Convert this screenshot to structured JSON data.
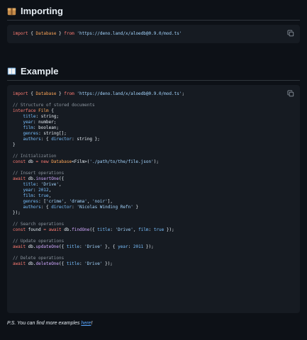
{
  "sections": {
    "importing": {
      "title": "Importing",
      "icon": "package-icon"
    },
    "example": {
      "title": "Example",
      "icon": "book-icon"
    }
  },
  "import_code": {
    "kw_import": "import",
    "brace_open": " { ",
    "cls_database": "Database",
    "brace_close": " } ",
    "kw_from": "from",
    "path": "'https://deno.land/x/aloedb@0.9.0/mod.ts'"
  },
  "example_code": {
    "l1": {
      "kw_import": "import",
      "a": " { ",
      "cls": "Database",
      "b": " } ",
      "kw_from": "from",
      "path": "'https://deno.land/x/aloedb@0.9.0/mod.ts'",
      "end": ";"
    },
    "c_structure": "// Structure of stored documents",
    "iface": {
      "kw": "interface",
      "name": " Film ",
      "open": "{"
    },
    "f_title": {
      "prop": "title",
      "rest": ": string;"
    },
    "f_year": {
      "prop": "year",
      "rest": ": number;"
    },
    "f_film": {
      "prop": "film",
      "rest": ": boolean;"
    },
    "f_genres": {
      "prop": "genres",
      "rest": ": string[];"
    },
    "f_authors": {
      "prop": "authors",
      "mid": ": { ",
      "prop2": "director",
      "rest": ": string };"
    },
    "iface_close": "}",
    "c_init": "// Initialization",
    "init": {
      "kw1": "const",
      "v": " db ",
      "eq": "=",
      "kw2": " new ",
      "cls": "Database",
      "gen": "<Film>(",
      "str": "'./path/to/the/file.json'",
      "end": ");"
    },
    "c_insert": "// Insert operations",
    "insert": {
      "kw": "await",
      "a": " db.",
      "fn": "insertOne",
      "b": "({"
    },
    "i_title": {
      "prop": "title",
      "a": ": ",
      "str": "'Drive'",
      "b": ","
    },
    "i_year": {
      "prop": "year",
      "a": ": ",
      "num": "2012",
      "b": ","
    },
    "i_film": {
      "prop": "film",
      "a": ": ",
      "num": "true",
      "b": ","
    },
    "i_genres": {
      "prop": "genres",
      "a": ": [",
      "s1": "'crime'",
      "c1": ", ",
      "s2": "'drama'",
      "c2": ", ",
      "s3": "'noir'",
      "b": "],"
    },
    "i_authors": {
      "prop": "authors",
      "a": ": { ",
      "prop2": "director",
      "b": ": ",
      "str": "'Nicolas Winding Refn'",
      "c": " }"
    },
    "insert_close": "});",
    "c_search": "// Search operations",
    "search": {
      "kw1": "const",
      "v": " found ",
      "eq": "=",
      "kw2": " await",
      "a": " db.",
      "fn": "findOne",
      "b": "({ ",
      "p1": "title",
      "c": ": ",
      "s1": "'Drive'",
      "d": ", ",
      "p2": "film",
      "e": ": ",
      "n1": "true",
      "f": " });"
    },
    "c_update": "// Update operations",
    "update": {
      "kw": "await",
      "a": " db.",
      "fn": "updateOne",
      "b": "({ ",
      "p1": "title",
      "c": ": ",
      "s1": "'Drive'",
      "d": " }, { ",
      "p2": "year",
      "e": ": ",
      "n1": "2011",
      "f": " });"
    },
    "c_delete": "// Delete operations",
    "delete": {
      "kw": "await",
      "a": " db.",
      "fn": "deleteOne",
      "b": "({ ",
      "p1": "title",
      "c": ": ",
      "s1": "'Drive'",
      "d": " });"
    }
  },
  "footer": {
    "prefix": "P.S. You can find more examples ",
    "link": "here",
    "suffix": "!"
  },
  "colors": {
    "background": "#0d1117",
    "code_bg": "#161b22",
    "keyword": "#ff7b72",
    "string": "#a5d6ff",
    "class": "#ffa657",
    "function": "#d2a8ff",
    "comment": "#8b949e",
    "link": "#58a6ff"
  }
}
